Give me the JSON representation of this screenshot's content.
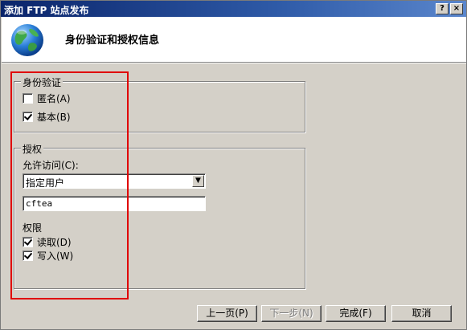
{
  "window": {
    "title": "添加 FTP 站点发布",
    "help_label": "?",
    "close_label": "×"
  },
  "header": {
    "title": "身份验证和授权信息",
    "icon": "globe-icon"
  },
  "authentication": {
    "legend": "身份验证",
    "options": [
      {
        "label": "匿名(A)",
        "checked": false
      },
      {
        "label": "基本(B)",
        "checked": true
      }
    ]
  },
  "authorization": {
    "legend": "授权",
    "allow_access_label": "允许访问(C):",
    "allow_access_value": "指定用户",
    "users_value": "cftea",
    "permissions_label": "权限",
    "permissions": [
      {
        "label": "读取(D)",
        "checked": true
      },
      {
        "label": "写入(W)",
        "checked": true
      }
    ]
  },
  "buttons": {
    "prev": "上一页(P)",
    "next": "下一步(N)",
    "finish": "完成(F)",
    "cancel": "取消"
  },
  "colors": {
    "titlebar": "#0a246a",
    "highlight": "#e00000",
    "face": "#d4d0c8"
  }
}
